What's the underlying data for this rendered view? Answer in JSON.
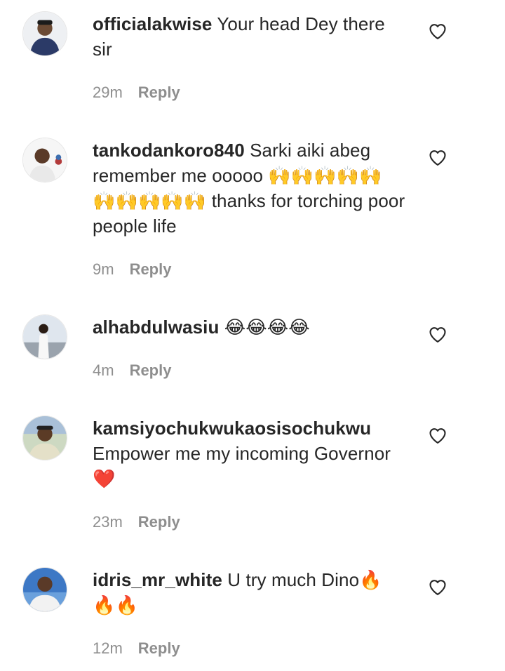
{
  "comments": [
    {
      "username": "officialakwise",
      "text": " Your head Dey there sir",
      "time": "29m",
      "reply_label": "Reply",
      "avatar_colors": [
        "#2b3a67",
        "#f0e6d8"
      ]
    },
    {
      "username": "tankodankoro840",
      "text": " Sarki aiki abeg remember me ooooo 🙌🙌🙌🙌🙌 🙌🙌🙌🙌🙌 thanks for torching poor people life",
      "time": "9m",
      "reply_label": "Reply",
      "avatar_colors": [
        "#f4f4f4",
        "#b23a3a"
      ]
    },
    {
      "username": "alhabdulwasiu",
      "text": " 😂😂😂😂",
      "time": "4m",
      "reply_label": "Reply",
      "avatar_colors": [
        "#dfe6ee",
        "#1f1f1f"
      ]
    },
    {
      "username": "kamsiyochukwukaosisochukwu",
      "text": " Empower me my incoming Governor ❤️",
      "time": "23m",
      "reply_label": "Reply",
      "avatar_colors": [
        "#cdd9c2",
        "#4a5d3a"
      ]
    },
    {
      "username": "idris_mr_white",
      "text": " U try much Dino🔥 🔥🔥",
      "time": "12m",
      "reply_label": "Reply",
      "avatar_colors": [
        "#3d78c5",
        "#f2f2f2"
      ]
    }
  ],
  "icons": {
    "like": "heart-outline-icon"
  },
  "colors": {
    "text": "#262626",
    "muted": "#8e8e8e",
    "background": "#ffffff"
  }
}
